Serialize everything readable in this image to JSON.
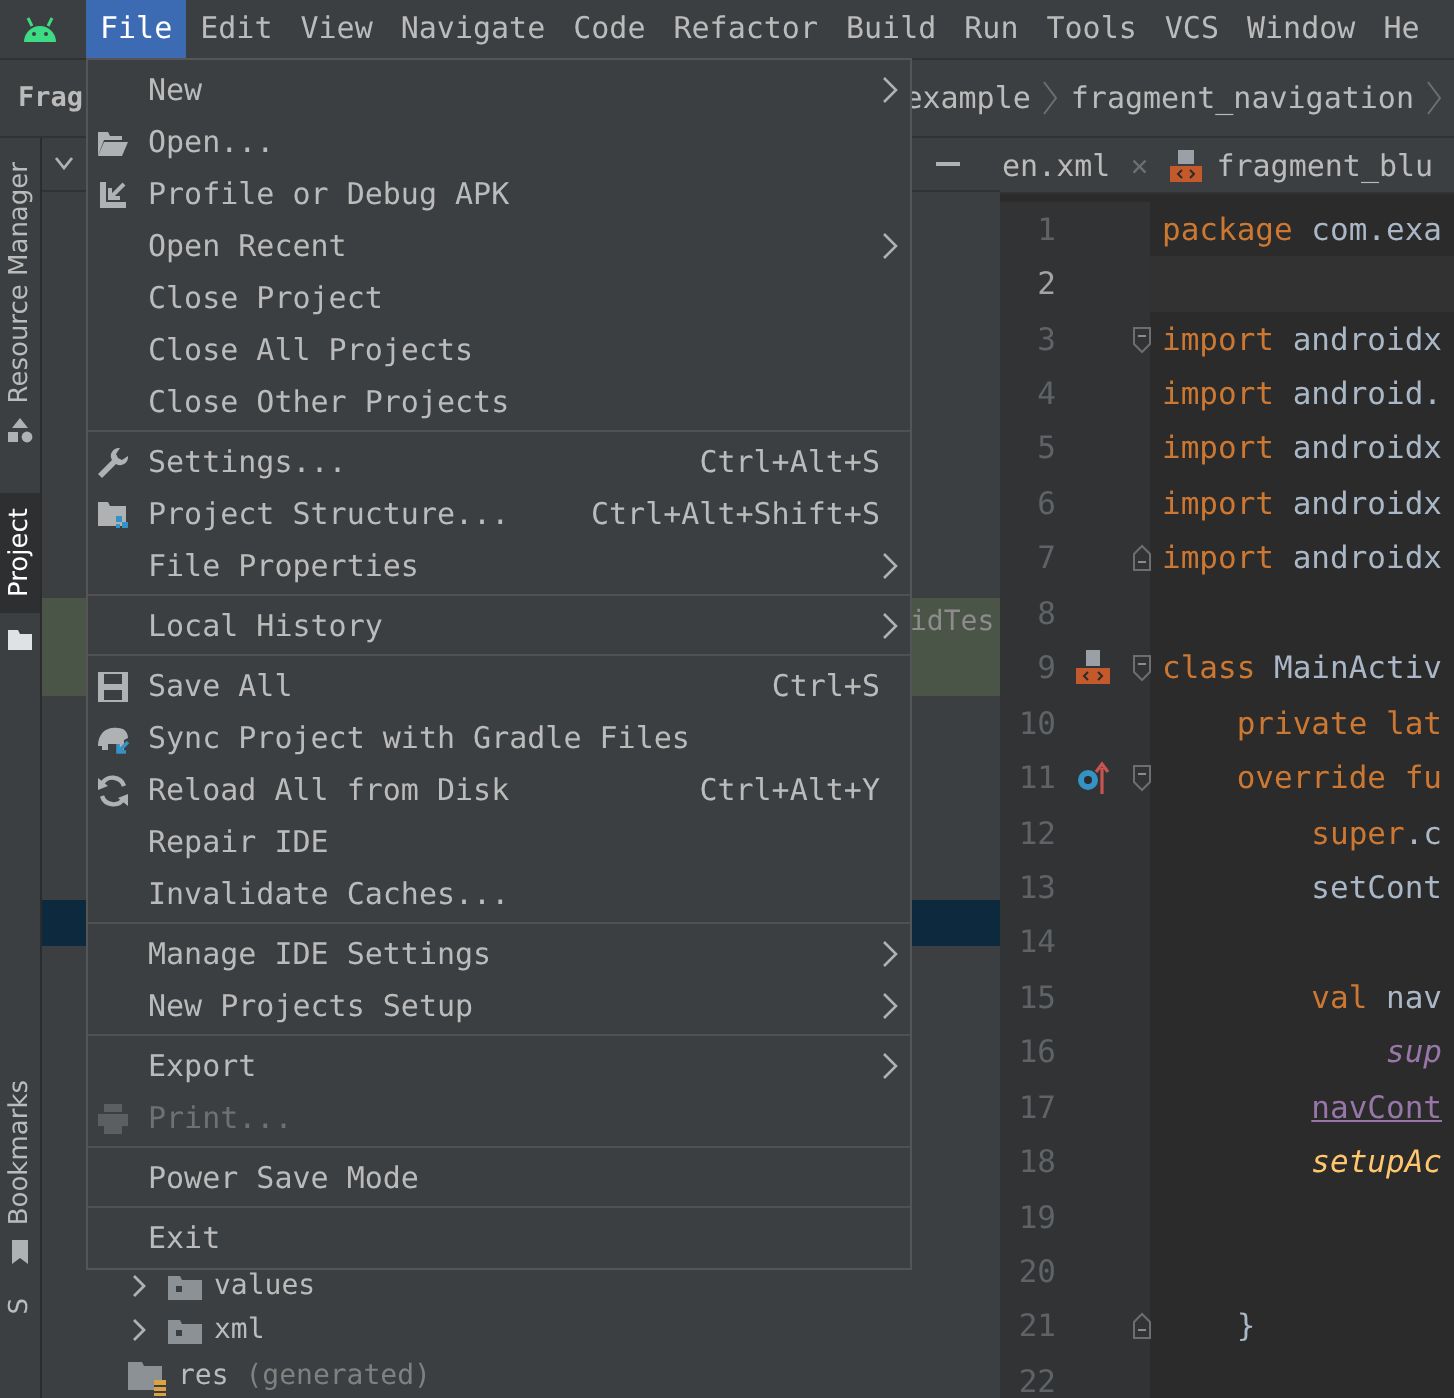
{
  "menubar": [
    {
      "label": "File",
      "selected": true
    },
    {
      "label": "Edit",
      "selected": false
    },
    {
      "label": "View",
      "selected": false
    },
    {
      "label": "Navigate",
      "selected": false
    },
    {
      "label": "Code",
      "selected": false
    },
    {
      "label": "Refactor",
      "selected": false
    },
    {
      "label": "Build",
      "selected": false
    },
    {
      "label": "Run",
      "selected": false
    },
    {
      "label": "Tools",
      "selected": false
    },
    {
      "label": "VCS",
      "selected": false
    },
    {
      "label": "Window",
      "selected": false
    },
    {
      "label": "He",
      "selected": false
    }
  ],
  "navbar": {
    "project": "Frag",
    "path": [
      "example",
      "fragment_navigation"
    ]
  },
  "tool_strip": [
    {
      "label": "Resource Manager",
      "selected": false
    },
    {
      "label": "Project",
      "selected": true
    },
    {
      "label": "Bookmarks",
      "selected": false
    },
    {
      "label": "S",
      "selected": false
    }
  ],
  "project_tree": [
    {
      "label": "idTes",
      "highlighted": true,
      "selected": false
    },
    {
      "highlighted": false,
      "selected": true
    },
    {
      "label": "values",
      "kind": "folder",
      "highlighted": false,
      "selected": false
    },
    {
      "label": "xml",
      "kind": "folder",
      "highlighted": false,
      "selected": false
    },
    {
      "label": "res",
      "note": "(generated)",
      "kind": "generated",
      "highlighted": false,
      "selected": false
    }
  ],
  "editor_tabs": [
    {
      "label": "en.xml",
      "close": "×",
      "selected": false
    },
    {
      "label": "fragment_blu",
      "selected": false
    }
  ],
  "file_menu": [
    {
      "kind": "item",
      "label": "New",
      "submenu": true,
      "disabled": false
    },
    {
      "kind": "item",
      "label": "Open...",
      "submenu": false,
      "disabled": false
    },
    {
      "kind": "item",
      "label": "Profile or Debug APK",
      "submenu": false,
      "disabled": false
    },
    {
      "kind": "item",
      "label": "Open Recent",
      "submenu": true,
      "disabled": false
    },
    {
      "kind": "item",
      "label": "Close Project",
      "submenu": false,
      "disabled": false
    },
    {
      "kind": "item",
      "label": "Close All Projects",
      "submenu": false,
      "disabled": false
    },
    {
      "kind": "item",
      "label": "Close Other Projects",
      "submenu": false,
      "disabled": false
    },
    {
      "kind": "separator"
    },
    {
      "kind": "item",
      "label": "Settings...",
      "shortcut": "Ctrl+Alt+S",
      "submenu": false,
      "disabled": false
    },
    {
      "kind": "item",
      "label": "Project Structure...",
      "shortcut": "Ctrl+Alt+Shift+S",
      "submenu": false,
      "disabled": false
    },
    {
      "kind": "item",
      "label": "File Properties",
      "submenu": true,
      "disabled": false
    },
    {
      "kind": "separator"
    },
    {
      "kind": "item",
      "label": "Local History",
      "submenu": true,
      "disabled": false
    },
    {
      "kind": "separator"
    },
    {
      "kind": "item",
      "label": "Save All",
      "shortcut": "Ctrl+S",
      "submenu": false,
      "disabled": false
    },
    {
      "kind": "item",
      "label": "Sync Project with Gradle Files",
      "submenu": false,
      "disabled": false
    },
    {
      "kind": "item",
      "label": "Reload All from Disk",
      "shortcut": "Ctrl+Alt+Y",
      "submenu": false,
      "disabled": false
    },
    {
      "kind": "item",
      "label": "Repair IDE",
      "submenu": false,
      "disabled": false
    },
    {
      "kind": "item",
      "label": "Invalidate Caches...",
      "submenu": false,
      "disabled": false
    },
    {
      "kind": "separator"
    },
    {
      "kind": "item",
      "label": "Manage IDE Settings",
      "submenu": true,
      "disabled": false
    },
    {
      "kind": "item",
      "label": "New Projects Setup",
      "submenu": true,
      "disabled": false
    },
    {
      "kind": "separator"
    },
    {
      "kind": "item",
      "label": "Export",
      "submenu": true,
      "disabled": false
    },
    {
      "kind": "item",
      "label": "Print...",
      "submenu": false,
      "disabled": true
    },
    {
      "kind": "separator"
    },
    {
      "kind": "item",
      "label": "Power Save Mode",
      "submenu": false,
      "disabled": false
    },
    {
      "kind": "separator"
    },
    {
      "kind": "item",
      "label": "Exit",
      "submenu": false,
      "disabled": false
    }
  ],
  "editor": [
    {
      "number": "1",
      "current": false,
      "tokens": [
        {
          "text": "package",
          "kind": "keyword"
        },
        {
          "text": " com.exa",
          "kind": "plain"
        }
      ]
    },
    {
      "number": "2",
      "current": true
    },
    {
      "number": "3",
      "current": false,
      "tokens": [
        {
          "text": "import",
          "kind": "keyword"
        },
        {
          "text": " androidx",
          "kind": "plain"
        }
      ]
    },
    {
      "number": "4",
      "current": false,
      "tokens": [
        {
          "text": "import",
          "kind": "keyword"
        },
        {
          "text": " android.",
          "kind": "plain"
        }
      ]
    },
    {
      "number": "5",
      "current": false,
      "tokens": [
        {
          "text": "import",
          "kind": "keyword"
        },
        {
          "text": " androidx",
          "kind": "plain"
        }
      ]
    },
    {
      "number": "6",
      "current": false,
      "tokens": [
        {
          "text": "import",
          "kind": "keyword"
        },
        {
          "text": " androidx",
          "kind": "plain"
        }
      ]
    },
    {
      "number": "7",
      "current": false,
      "tokens": [
        {
          "text": "import",
          "kind": "keyword"
        },
        {
          "text": " androidx",
          "kind": "plain"
        }
      ]
    },
    {
      "number": "8",
      "current": false
    },
    {
      "number": "9",
      "current": false,
      "tokens": [
        {
          "text": "class",
          "kind": "keyword"
        },
        {
          "text": " MainActiv",
          "kind": "plain"
        }
      ]
    },
    {
      "number": "10",
      "current": false,
      "tokens": [
        {
          "text": "    private lat",
          "kind": "keyword"
        }
      ]
    },
    {
      "number": "11",
      "current": false,
      "tokens": [
        {
          "text": "    override fu",
          "kind": "keyword"
        }
      ]
    },
    {
      "number": "12",
      "current": false,
      "tokens": [
        {
          "text": "        super",
          "kind": "keyword"
        },
        {
          "text": ".c",
          "kind": "plain"
        }
      ]
    },
    {
      "number": "13",
      "current": false,
      "tokens": [
        {
          "text": "        setCont",
          "kind": "plain"
        }
      ]
    },
    {
      "number": "14",
      "current": false
    },
    {
      "number": "15",
      "current": false,
      "tokens": [
        {
          "text": "        val",
          "kind": "keyword"
        },
        {
          "text": " nav",
          "kind": "plain"
        }
      ]
    },
    {
      "number": "16",
      "current": false,
      "tokens": [
        {
          "text": "            sup",
          "kind": "static"
        }
      ]
    },
    {
      "number": "17",
      "current": false,
      "tokens": [
        {
          "text": "        navCont",
          "kind": "variable"
        }
      ]
    },
    {
      "number": "18",
      "current": false,
      "tokens": [
        {
          "text": "        setupAc",
          "kind": "function"
        }
      ]
    },
    {
      "number": "19",
      "current": false
    },
    {
      "number": "20",
      "current": false
    },
    {
      "number": "21",
      "current": false,
      "tokens": [
        {
          "text": "    }",
          "kind": "plain"
        }
      ]
    },
    {
      "number": "22",
      "current": false
    }
  ]
}
